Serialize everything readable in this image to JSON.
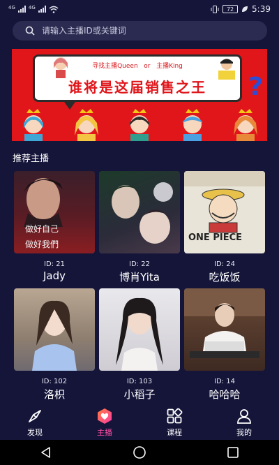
{
  "status_bar": {
    "network_1": "4G",
    "network_2": "4G",
    "battery": "72",
    "time": "5:39"
  },
  "search": {
    "placeholder": "请输入主播ID或关键词",
    "icon": "search-icon"
  },
  "banner": {
    "subtitle_left": "寻找主播Queen",
    "subtitle_mid": "or",
    "subtitle_right": "主播King",
    "title": "谁将是这届销售之王",
    "question_mark": "?"
  },
  "section": {
    "title": "推荐主播"
  },
  "streamers": [
    {
      "id_label": "ID: 21",
      "name": "Jady",
      "img_text_1": "做好自己",
      "img_text_2": "做好我們"
    },
    {
      "id_label": "ID: 22",
      "name": "博肖Yita",
      "img_text_1": "",
      "img_text_2": ""
    },
    {
      "id_label": "ID: 24",
      "name": "吃饭饭",
      "img_text_1": "ONE PIECE",
      "img_text_2": ""
    },
    {
      "id_label": "ID: 102",
      "name": "洛枳",
      "img_text_1": "",
      "img_text_2": ""
    },
    {
      "id_label": "ID: 103",
      "name": "小稻子",
      "img_text_1": "",
      "img_text_2": ""
    },
    {
      "id_label": "ID: 14",
      "name": "哈哈哈",
      "img_text_1": "",
      "img_text_2": ""
    }
  ],
  "nav": {
    "items": [
      {
        "label": "发现",
        "icon": "compass-icon"
      },
      {
        "label": "主播",
        "icon": "heart-badge-icon"
      },
      {
        "label": "课程",
        "icon": "grid-icon"
      },
      {
        "label": "我的",
        "icon": "person-icon"
      }
    ],
    "active_color": "#ff4fa3"
  },
  "colors": {
    "background": "#15153a",
    "banner_red": "#e0161b",
    "search_bg": "#2b2b52"
  }
}
